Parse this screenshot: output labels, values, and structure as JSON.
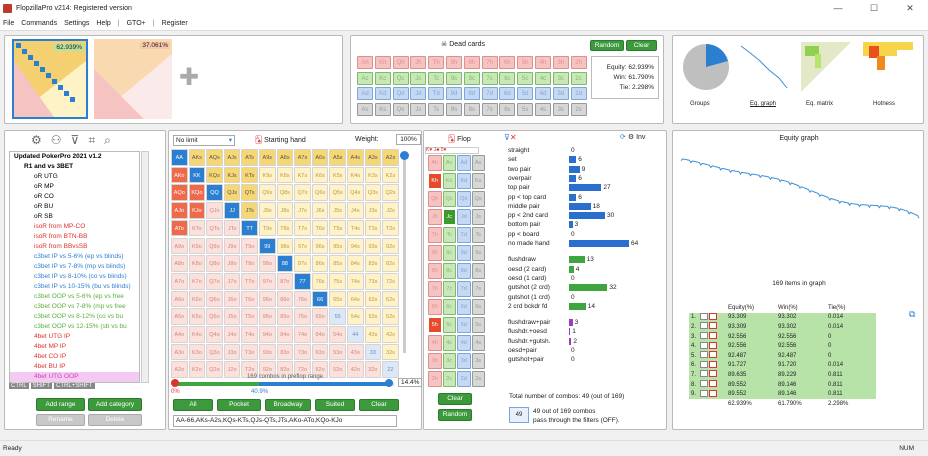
{
  "app": {
    "title": "FlopzillaPro v214: Registered version",
    "winctl": [
      "—",
      "☐",
      "✕"
    ]
  },
  "menu": [
    "File",
    "Commands",
    "Settings",
    "Help",
    "|",
    "GTO+",
    "|",
    "Register"
  ],
  "range_thumbs": {
    "a_pct": "62.939%",
    "b_pct": "37.061%",
    "add": "✚"
  },
  "dead": {
    "title": "Dead cards",
    "random": "Random",
    "clear": "Clear",
    "equity": "Equity: 62.939%",
    "win": "Win: 61.790%",
    "tie": "Tie: 2.298%",
    "rows": [
      [
        "Ah",
        "Kh",
        "Qh",
        "Jh",
        "Th",
        "9h",
        "8h",
        "7h",
        "6h",
        "5h",
        "4h",
        "3h",
        "2h"
      ],
      [
        "Ac",
        "Kc",
        "Qc",
        "Jc",
        "Tc",
        "9c",
        "8c",
        "7c",
        "6c",
        "5c",
        "4c",
        "3c",
        "2c"
      ],
      [
        "Ad",
        "Kd",
        "Qd",
        "Jd",
        "Td",
        "9d",
        "8d",
        "7d",
        "6d",
        "5d",
        "4d",
        "3d",
        "2d"
      ],
      [
        "As",
        "Ks",
        "Qs",
        "Js",
        "Ts",
        "9s",
        "8s",
        "7s",
        "6s",
        "5s",
        "4s",
        "3s",
        "2s"
      ]
    ]
  },
  "views": [
    "Groups",
    "Eq. graph",
    "Eq. matrix",
    "Hotness"
  ],
  "tree": {
    "items": [
      {
        "t": "Updated PokerPro 2021 v1.2",
        "c": "#000",
        "b": 1,
        "l": 0
      },
      {
        "t": "R1 and vs 3BET",
        "c": "#000",
        "b": 1,
        "l": 1
      },
      {
        "t": "oR UTG",
        "c": "#000",
        "l": 2
      },
      {
        "t": "oR MP",
        "c": "#000",
        "l": 2
      },
      {
        "t": "oR CO",
        "c": "#000",
        "l": 2
      },
      {
        "t": "oR BU",
        "c": "#000",
        "l": 2
      },
      {
        "t": "oR SB",
        "c": "#000",
        "l": 2
      },
      {
        "t": "isoR from MP-CO",
        "c": "#e0312b",
        "l": 2
      },
      {
        "t": "isoR from BTN-BB",
        "c": "#e0312b",
        "l": 2
      },
      {
        "t": "isoR from BBvsSB",
        "c": "#e0312b",
        "l": 2
      },
      {
        "t": "c3bet IP vs 5-6% (ep vs blinds)",
        "c": "#2b7fd1",
        "l": 2
      },
      {
        "t": "c3bet IP vs 7-8% (mp vs blinds)",
        "c": "#2b7fd1",
        "l": 2
      },
      {
        "t": "c3bet IP vs 8-10% (co vs blinds)",
        "c": "#2b7fd1",
        "l": 2
      },
      {
        "t": "c3bet IP vs 10-15% (bu vs blinds)",
        "c": "#2b7fd1",
        "l": 2
      },
      {
        "t": "c3bet OOP vs 5-6% (ep vs free",
        "c": "#5ab03b",
        "l": 2
      },
      {
        "t": "c3bet OOP vs 7-8% (mp vs free",
        "c": "#5ab03b",
        "l": 2
      },
      {
        "t": "c3bet OOP vs 8-12% (co vs bu",
        "c": "#5ab03b",
        "l": 2
      },
      {
        "t": "c3bet OOP vs 12-15% (sb vs bu",
        "c": "#5ab03b",
        "l": 2
      },
      {
        "t": "4bet UTG IP",
        "c": "#e0312b",
        "l": 2
      },
      {
        "t": "4bet MP IP",
        "c": "#e0312b",
        "l": 2
      },
      {
        "t": "4bet CO IP",
        "c": "#e0312b",
        "l": 2
      },
      {
        "t": "4bet BU IP",
        "c": "#e0312b",
        "l": 2
      },
      {
        "t": "4bet UTG OOP",
        "c": "#d040c0",
        "l": 2
      }
    ],
    "mods": [
      "CTRL",
      "SHIFT",
      "CTRL+SHIFT"
    ],
    "add_range": "Add range",
    "add_category": "Add category",
    "rename": "Rename",
    "delete": "Delete"
  },
  "hand": {
    "mode": "No limit",
    "title": "Starting hand",
    "weight_label": "Weight:",
    "weight": "100%",
    "combos": "169 combos in preflop range",
    "pct": "14.4%",
    "lo": "0%",
    "mid": "40.9%",
    "btns": [
      "All",
      "Pocket",
      "Broadway",
      "Suited",
      "Clear"
    ],
    "range_text": "AA-66,AKs-A2s,KQs-KTs,QJs-QTs,JTs,AKo-ATo,KQo-KJo"
  },
  "grid_labels": [
    "AA",
    "AKs",
    "AQs",
    "AJs",
    "ATs",
    "A9s",
    "A8s",
    "A7s",
    "A6s",
    "A5s",
    "A4s",
    "A3s",
    "A2s",
    "AKo",
    "KK",
    "KQs",
    "KJs",
    "KTs",
    "K9s",
    "K8s",
    "K7s",
    "K6s",
    "K5s",
    "K4s",
    "K3s",
    "K2s",
    "AQo",
    "KQo",
    "QQ",
    "QJs",
    "QTs",
    "Q9s",
    "Q8s",
    "Q7s",
    "Q6s",
    "Q5s",
    "Q4s",
    "Q3s",
    "Q2s",
    "AJo",
    "KJo",
    "QJo",
    "JJ",
    "JTs",
    "J9s",
    "J8s",
    "J7s",
    "J6s",
    "J5s",
    "J4s",
    "J3s",
    "J2s",
    "ATo",
    "KTo",
    "QTo",
    "JTo",
    "TT",
    "T9s",
    "T8s",
    "T7s",
    "T6s",
    "T5s",
    "T4s",
    "T3s",
    "T2s",
    "A9o",
    "K9o",
    "Q9o",
    "J9o",
    "T9o",
    "99",
    "98s",
    "97s",
    "96s",
    "95s",
    "94s",
    "93s",
    "92s",
    "A8o",
    "K8o",
    "Q8o",
    "J8o",
    "T8o",
    "98o",
    "88",
    "87s",
    "86s",
    "85s",
    "84s",
    "83s",
    "82s",
    "A7o",
    "K7o",
    "Q7o",
    "J7o",
    "T7o",
    "97o",
    "87o",
    "77",
    "76s",
    "75s",
    "74s",
    "73s",
    "72s",
    "A6o",
    "K6o",
    "Q6o",
    "J6o",
    "T6o",
    "96o",
    "86o",
    "76o",
    "66",
    "65s",
    "64s",
    "63s",
    "62s",
    "A5o",
    "K5o",
    "Q5o",
    "J5o",
    "T5o",
    "95o",
    "85o",
    "75o",
    "65o",
    "55",
    "54s",
    "53s",
    "52s",
    "A4o",
    "K4o",
    "Q4o",
    "J4o",
    "T4o",
    "94o",
    "84o",
    "74o",
    "64o",
    "54o",
    "44",
    "43s",
    "42s",
    "A3o",
    "K3o",
    "Q3o",
    "J3o",
    "T3o",
    "93o",
    "83o",
    "73o",
    "63o",
    "53o",
    "43o",
    "33",
    "32s",
    "A2o",
    "K2o",
    "Q2o",
    "J2o",
    "T2o",
    "92o",
    "82o",
    "72o",
    "62o",
    "52o",
    "42o",
    "32o",
    "22"
  ],
  "flop": {
    "title": "Flop",
    "clear": "Clear",
    "random": "Random",
    "cards": [
      [
        "Ah",
        "Ac",
        "Ad",
        "As"
      ],
      [
        "Kh",
        "Kc",
        "Kd",
        "Ks"
      ],
      [
        "Qh",
        "Qc",
        "Qd",
        "Qs"
      ],
      [
        "Jh",
        "Jc",
        "Jd",
        "Js"
      ],
      [
        "Th",
        "Tc",
        "Td",
        "Ts"
      ],
      [
        "9h",
        "9c",
        "9d",
        "9s"
      ],
      [
        "8h",
        "8c",
        "8d",
        "8s"
      ],
      [
        "7h",
        "7c",
        "7d",
        "7s"
      ],
      [
        "6h",
        "6c",
        "6d",
        "6s"
      ],
      [
        "5h",
        "5c",
        "5d",
        "5s"
      ],
      [
        "4h",
        "4c",
        "4d",
        "4s"
      ],
      [
        "3h",
        "3c",
        "3d",
        "3s"
      ],
      [
        "2h",
        "2c",
        "2d",
        "2s"
      ]
    ]
  },
  "filters": {
    "inv": "Inv",
    "g1": [
      {
        "n": "straight",
        "v": "0"
      },
      {
        "n": "set",
        "v": "6"
      },
      {
        "n": "two pair",
        "v": "9"
      },
      {
        "n": "overpair",
        "v": "6"
      },
      {
        "n": "top pair",
        "v": "27"
      },
      {
        "n": "pp < top card",
        "v": "6"
      },
      {
        "n": "middle pair",
        "v": "18"
      },
      {
        "n": "pp < 2nd card",
        "v": "30"
      },
      {
        "n": "bottom pair",
        "v": "3"
      },
      {
        "n": "pp < board",
        "v": "0"
      },
      {
        "n": "no made hand",
        "v": "64"
      }
    ],
    "g2": [
      {
        "n": "flushdraw",
        "v": "13"
      },
      {
        "n": "oesd (2 card)",
        "v": "4"
      },
      {
        "n": "oesd (1 card)",
        "v": "0"
      },
      {
        "n": "gutshot (2 crd)",
        "v": "32"
      },
      {
        "n": "gutshot (1 crd)",
        "v": "0"
      },
      {
        "n": "2 crd bckdr fd",
        "v": "14"
      }
    ],
    "g3": [
      {
        "n": "flushdraw+pair",
        "v": "3"
      },
      {
        "n": "flushdr.+oesd",
        "v": "1"
      },
      {
        "n": "flushdr.+gutsh.",
        "v": "2"
      },
      {
        "n": "oesd+pair",
        "v": "0"
      },
      {
        "n": "gutshot+pair",
        "v": "0"
      }
    ],
    "total": "Total number of combos: 49 (out of 169)",
    "badge": "49",
    "note1": "49 out of 169 combos",
    "note2": "pass through the filters (OFF)."
  },
  "eq": {
    "title": "Equity graph",
    "caption": "169 items in graph",
    "headers": [
      "Equity(%)",
      "Win(%)",
      "Tie(%)"
    ],
    "rows": [
      [
        "1.",
        "93.309",
        "93.302",
        "0.014"
      ],
      [
        "2.",
        "93.309",
        "93.302",
        "0.014"
      ],
      [
        "3.",
        "92.556",
        "92.556",
        "0"
      ],
      [
        "4.",
        "92.556",
        "92.556",
        "0"
      ],
      [
        "5.",
        "92.487",
        "92.487",
        "0"
      ],
      [
        "6.",
        "91.727",
        "91.720",
        "0.014"
      ],
      [
        "7.",
        "89.635",
        "89.229",
        "0.811"
      ],
      [
        "8.",
        "89.552",
        "89.146",
        "0.811"
      ],
      [
        "9.",
        "89.552",
        "89.146",
        "0.811"
      ]
    ],
    "totals": [
      "62.939%",
      "61.790%",
      "2.298%"
    ]
  },
  "status": {
    "left": "Ready",
    "right": "NUM"
  }
}
